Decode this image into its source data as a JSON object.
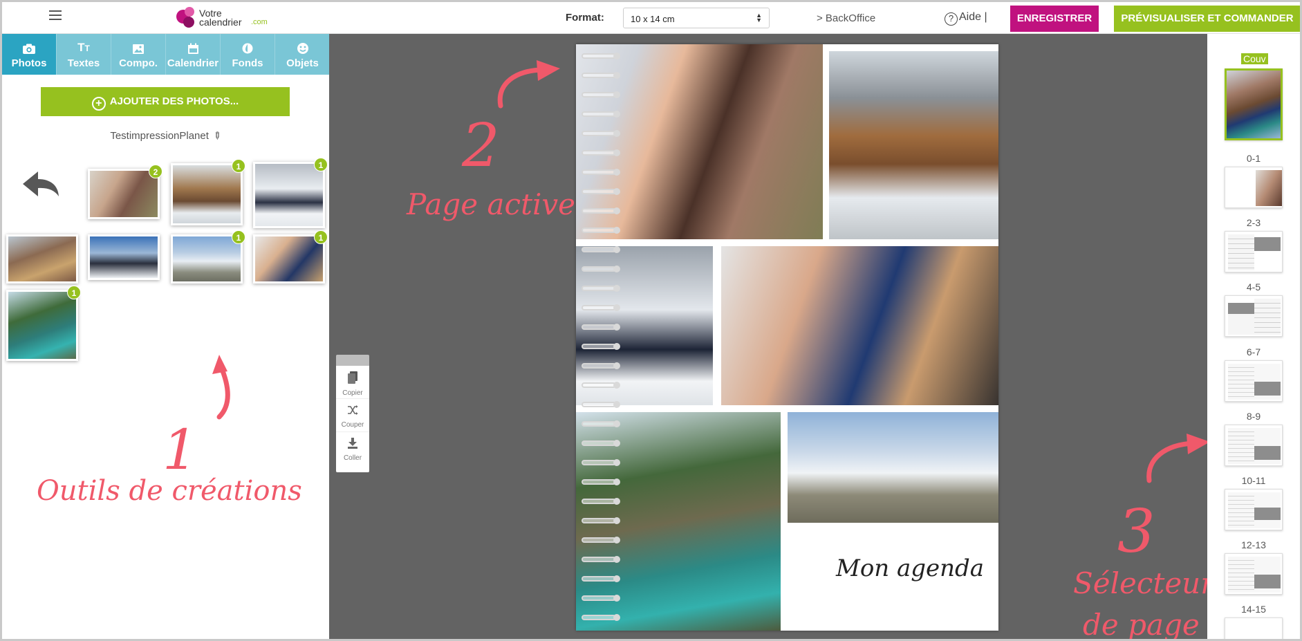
{
  "header": {
    "menu_icon": "hamburger-icon",
    "logo": {
      "line1": "Votre",
      "line2": "calendrier",
      "tld": ".com"
    },
    "format_label": "Format:",
    "format_value": "10 x 14 cm",
    "backoffice_label": "> BackOffice",
    "help_label": "Aide |",
    "save_label": "ENREGISTRER",
    "order_label": "PRÉVISUALISER ET COMMANDER",
    "colors": {
      "save": "#c0127f",
      "order": "#96c11f"
    }
  },
  "tools": {
    "tabs": [
      {
        "label": "Photos",
        "icon": "camera-icon"
      },
      {
        "label": "Textes",
        "icon": "text-icon"
      },
      {
        "label": "Compo.",
        "icon": "image-icon"
      },
      {
        "label": "Calendrier",
        "icon": "calendar-icon"
      },
      {
        "label": "Fonds",
        "icon": "drop-icon"
      },
      {
        "label": "Objets",
        "icon": "smiley-icon"
      }
    ],
    "add_photos_label": "AJOUTER DES PHOTOS...",
    "album_name": "TestimpressionPlanet",
    "photos": [
      {
        "badge": "2"
      },
      {
        "badge": "1"
      },
      {
        "badge": "1"
      },
      {
        "badge": ""
      },
      {
        "badge": ""
      },
      {
        "badge": "1"
      },
      {
        "badge": "1"
      },
      {
        "badge": "1"
      }
    ]
  },
  "editor": {
    "calendar_title": "Mon agenda",
    "actions": {
      "copy": "Copier",
      "cut": "Couper",
      "paste": "Coller"
    }
  },
  "pages": {
    "cover_label": "Couv",
    "items": [
      "0-1",
      "2-3",
      "4-5",
      "6-7",
      "8-9",
      "10-11",
      "12-13",
      "14-15"
    ]
  },
  "annotations": {
    "n1": "1",
    "t1": "Outils de créations",
    "n2": "2",
    "t2": "Page active",
    "n3": "3",
    "t3a": "Sélecteur",
    "t3b": "de page",
    "color": "#f0596a"
  }
}
